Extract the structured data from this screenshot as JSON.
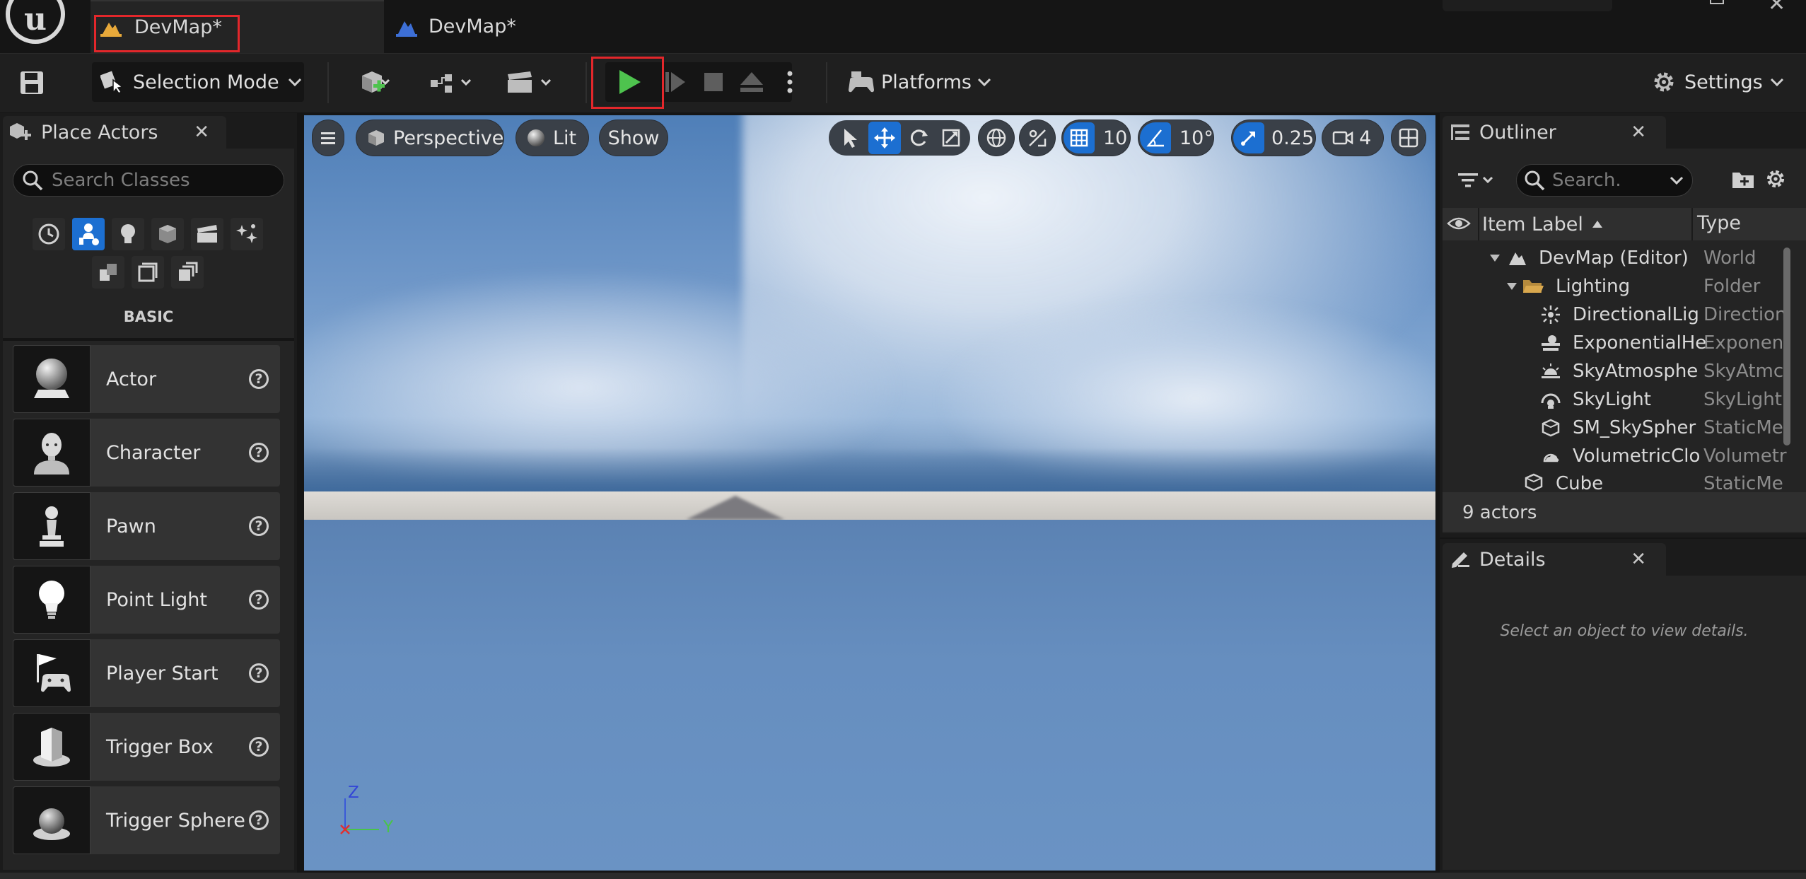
{
  "window": {
    "tabs": [
      {
        "label": "DevMap*",
        "active": true
      },
      {
        "label": "DevMap*",
        "active": false
      }
    ]
  },
  "toolbar": {
    "selection_mode_label": "Selection Mode",
    "platforms_label": "Platforms",
    "settings_label": "Settings",
    "play_color": "#4ec34e",
    "highlight_color": "#e3272b"
  },
  "place_actors": {
    "title": "Place Actors",
    "search_placeholder": "Search Classes",
    "category_label": "BASIC",
    "items": [
      {
        "label": "Actor",
        "icon": "sphere-pedestal-icon"
      },
      {
        "label": "Character",
        "icon": "character-icon"
      },
      {
        "label": "Pawn",
        "icon": "pawn-icon"
      },
      {
        "label": "Point Light",
        "icon": "lightbulb-icon"
      },
      {
        "label": "Player Start",
        "icon": "flag-gamepad-icon"
      },
      {
        "label": "Trigger Box",
        "icon": "trigger-box-icon"
      },
      {
        "label": "Trigger Sphere",
        "icon": "trigger-sphere-icon"
      }
    ]
  },
  "viewport": {
    "perspective_label": "Perspective",
    "lit_label": "Lit",
    "show_label": "Show",
    "grid_snap_value": "10",
    "rotation_snap_value": "10°",
    "scale_snap_value": "0.25",
    "camera_speed_value": "4",
    "axis_z": "Z",
    "axis_y": "Y"
  },
  "outliner": {
    "title": "Outliner",
    "search_placeholder": "Search.",
    "col_label": "Item Label",
    "col_type": "Type",
    "rows": [
      {
        "name": "DevMap (Editor)",
        "type": "World"
      },
      {
        "name": "Lighting",
        "type": "Folder"
      },
      {
        "name": "DirectionalLig",
        "type": "Direction"
      },
      {
        "name": "ExponentialHe",
        "type": "Exponen"
      },
      {
        "name": "SkyAtmosphe",
        "type": "SkyAtmc"
      },
      {
        "name": "SkyLight",
        "type": "SkyLight"
      },
      {
        "name": "SM_SkySpher",
        "type": "StaticMe"
      },
      {
        "name": "VolumetricClo",
        "type": "Volumetr"
      },
      {
        "name": "Cube",
        "type": "StaticMe"
      }
    ],
    "actor_count": "9 actors"
  },
  "details": {
    "title": "Details",
    "empty_message": "Select an object to view details."
  }
}
